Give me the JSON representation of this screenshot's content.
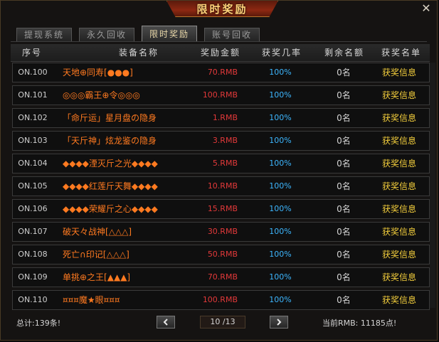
{
  "window": {
    "title": "限时奖励",
    "close_glyph": "✕"
  },
  "tabs": [
    {
      "label": "提现系统",
      "active": false
    },
    {
      "label": "永久回收",
      "active": false
    },
    {
      "label": "限时奖励",
      "active": true
    },
    {
      "label": "账号回收",
      "active": false
    }
  ],
  "table": {
    "headers": {
      "id": "序号",
      "name": "装备名称",
      "amount": "奖励金额",
      "rate": "获奖几率",
      "remaining": "剩余名额",
      "winners": "获奖名单"
    },
    "rows": [
      {
        "id": "ON.100",
        "name": "天地⊕同寿[●●●]",
        "amount": "70.RMB",
        "rate": "100%",
        "remaining": "0名",
        "info": "获奖信息"
      },
      {
        "id": "ON.101",
        "name": "◎◎◎霸王⊕令◎◎◎",
        "amount": "100.RMB",
        "rate": "100%",
        "remaining": "0名",
        "info": "获奖信息"
      },
      {
        "id": "ON.102",
        "name": "「命斤运」星月盘の隐身",
        "amount": "1.RMB",
        "rate": "100%",
        "remaining": "0名",
        "info": "获奖信息"
      },
      {
        "id": "ON.103",
        "name": "「天斤神」炫龙鉴の隐身",
        "amount": "3.RMB",
        "rate": "100%",
        "remaining": "0名",
        "info": "获奖信息"
      },
      {
        "id": "ON.104",
        "name": "◆◆◆◆湮灭斤之光◆◆◆◆",
        "amount": "5.RMB",
        "rate": "100%",
        "remaining": "0名",
        "info": "获奖信息"
      },
      {
        "id": "ON.105",
        "name": "◆◆◆◆红莲斤天舞◆◆◆◆",
        "amount": "10.RMB",
        "rate": "100%",
        "remaining": "0名",
        "info": "获奖信息"
      },
      {
        "id": "ON.106",
        "name": "◆◆◆◆荣耀斤之心◆◆◆◆",
        "amount": "15.RMB",
        "rate": "100%",
        "remaining": "0名",
        "info": "获奖信息"
      },
      {
        "id": "ON.107",
        "name": "破天々战神[△△△]",
        "amount": "30.RMB",
        "rate": "100%",
        "remaining": "0名",
        "info": "获奖信息"
      },
      {
        "id": "ON.108",
        "name": "死亡∩印记[△△△]",
        "amount": "50.RMB",
        "rate": "100%",
        "remaining": "0名",
        "info": "获奖信息"
      },
      {
        "id": "ON.109",
        "name": "单挑⊕之王[▲▲▲]",
        "amount": "70.RMB",
        "rate": "100%",
        "remaining": "0名",
        "info": "获奖信息"
      },
      {
        "id": "ON.110",
        "name": "¤¤¤魔★眼¤¤¤",
        "amount": "100.RMB",
        "rate": "100%",
        "remaining": "0名",
        "info": "获奖信息"
      }
    ]
  },
  "footer": {
    "total": "总计:139条!",
    "page": "10 /13",
    "balance": "当前RMB: 11185点!",
    "prev_icon": "chevron-left-icon",
    "next_icon": "chevron-right-icon"
  },
  "colors": {
    "accent": "#ff7a20",
    "amount": "#e3393a",
    "rate": "#3db7ff",
    "link": "#f3ce3c",
    "title": "#ffd37a"
  }
}
